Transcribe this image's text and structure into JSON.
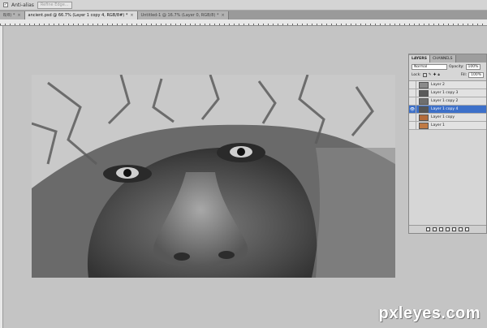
{
  "options": {
    "antialias_label": "Anti-alias",
    "refine_label": "Refine Edge..."
  },
  "tabs": [
    {
      "label": "B/8) *",
      "close": "×"
    },
    {
      "label": "ancient.psd @ 66.7% (Layer 1 copy 4, RGB/8#) *",
      "close": "×"
    },
    {
      "label": "Untitled-1 @ 16.7% (Layer 0, RGB/8) *",
      "close": "×"
    }
  ],
  "layers_panel": {
    "tabs": [
      "LAYERS",
      "CHANNELS"
    ],
    "blend_mode": "Normal",
    "opacity_label": "Opacity:",
    "opacity_value": "100%",
    "lock_label": "Lock:",
    "fill_label": "Fill:",
    "fill_value": "100%",
    "layers": [
      {
        "name": "Layer 2",
        "visible": false,
        "selected": false,
        "thumb": "#8a8a8a"
      },
      {
        "name": "Layer 1 copy 3",
        "visible": false,
        "selected": false,
        "thumb": "#5a5a5a"
      },
      {
        "name": "Layer 1 copy 2",
        "visible": false,
        "selected": false,
        "thumb": "#6f6f6f"
      },
      {
        "name": "Layer 1 copy 4",
        "visible": true,
        "selected": true,
        "thumb": "#555555"
      },
      {
        "name": "Layer 1 copy",
        "visible": false,
        "selected": false,
        "thumb": "#b36b3a"
      },
      {
        "name": "Layer 1",
        "visible": false,
        "selected": false,
        "thumb": "#c07a44"
      }
    ]
  },
  "watermark": "pxleyes.com"
}
